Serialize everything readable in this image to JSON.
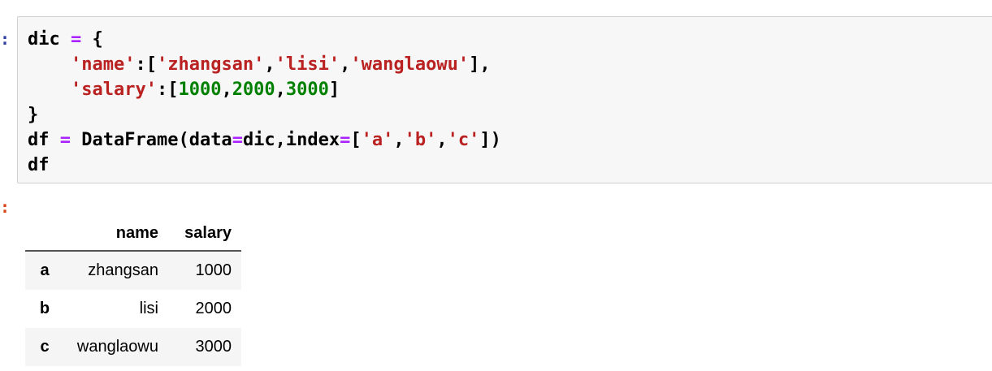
{
  "input_prompt": ":",
  "output_prompt": ":",
  "code": {
    "line1": {
      "var": "dic",
      "op": "=",
      "brace": "{"
    },
    "line2": {
      "key": "'name'",
      "colon": ":[",
      "v1": "'zhangsan'",
      "c1": ",",
      "v2": "'lisi'",
      "c2": ",",
      "v3": "'wanglaowu'",
      "end": "],"
    },
    "line3": {
      "key": "'salary'",
      "colon": ":[",
      "n1": "1000",
      "c1": ",",
      "n2": "2000",
      "c2": ",",
      "n3": "3000",
      "end": "]"
    },
    "line4": {
      "brace": "}"
    },
    "line5": {
      "var": "df",
      "op": "=",
      "call": "DataFrame(data",
      "op2": "=",
      "arg": "dic,index",
      "op3": "=",
      "open": "[",
      "i1": "'a'",
      "c1": ",",
      "i2": "'b'",
      "c2": ",",
      "i3": "'c'",
      "close": "])"
    },
    "line6": {
      "var": "df"
    }
  },
  "table": {
    "columns": [
      "name",
      "salary"
    ],
    "rows": [
      {
        "index": "a",
        "name": "zhangsan",
        "salary": "1000"
      },
      {
        "index": "b",
        "name": "lisi",
        "salary": "2000"
      },
      {
        "index": "c",
        "name": "wanglaowu",
        "salary": "3000"
      }
    ]
  },
  "colors": {
    "string": "#ba2121",
    "number": "#008000",
    "operator": "#aa22ff",
    "cell_background": "#f7f7f7",
    "cell_border": "#cfcfcf"
  }
}
